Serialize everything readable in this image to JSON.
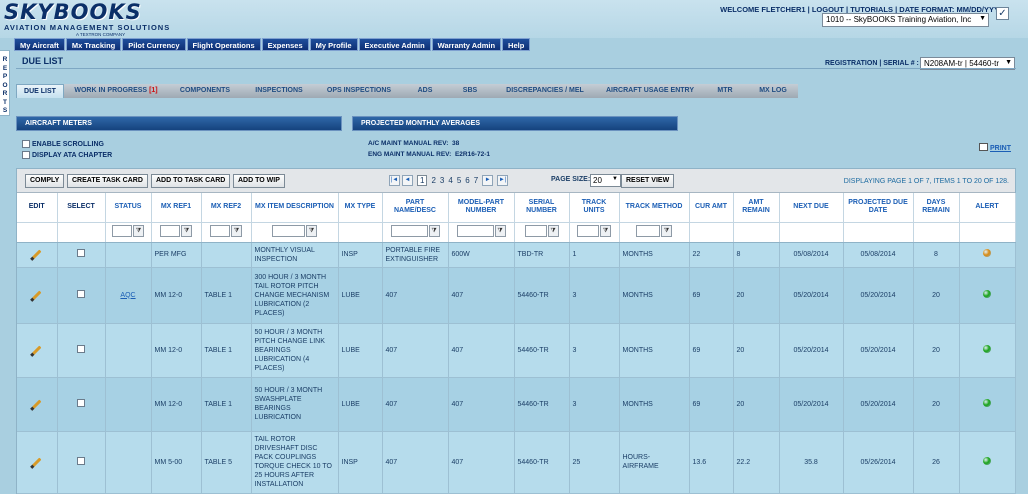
{
  "brand": {
    "logo_text": "SKYBOOKS",
    "subtitle": "AVIATION MANAGEMENT SOLUTIONS",
    "tagline": "A TEXTRON COMPANY"
  },
  "user_bar": {
    "welcome": "WELCOME FLETCHER1",
    "sep": " | ",
    "logout": "LOGOUT",
    "tutorials": "TUTORIALS",
    "date_format": "DATE FORMAT: MM/DD/YYYY",
    "tenant": "1010 -- SkyBOOKS Training Aviation, Inc"
  },
  "side_tab": {
    "label": "REPORTS"
  },
  "nav": [
    "My Aircraft",
    "Mx Tracking",
    "Pilot Currency",
    "Flight Operations",
    "Expenses",
    "My Profile",
    "Executive Admin",
    "Warranty Admin",
    "Help"
  ],
  "page": {
    "title": "DUE LIST",
    "reg_label": "REGISTRATION | SERIAL # :",
    "reg_value": "N208AM-tr | 54460-tr"
  },
  "tabs": [
    {
      "label": "DUE LIST"
    },
    {
      "label": "WORK IN PROGRESS",
      "badge": "[1]"
    },
    {
      "label": "COMPONENTS"
    },
    {
      "label": "INSPECTIONS"
    },
    {
      "label": "OPS INSPECTIONS"
    },
    {
      "label": "ADS"
    },
    {
      "label": "SBS"
    },
    {
      "label": "DISCREPANCIES / MEL"
    },
    {
      "label": "AIRCRAFT USAGE ENTRY"
    },
    {
      "label": "MTR"
    },
    {
      "label": "MX LOG"
    }
  ],
  "panels": {
    "meters": "AIRCRAFT METERS",
    "projected": "PROJECTED MONTHLY AVERAGES"
  },
  "options": {
    "scrolling": "ENABLE SCROLLING",
    "ata": "DISPLAY ATA CHAPTER"
  },
  "manuals": {
    "ac": "A/C MAINT MANUAL REV:",
    "ac_val": "38",
    "eng": "ENG MAINT MANUAL REV:",
    "eng_val": "E2R16-72-1"
  },
  "print_label": "PRINT",
  "toolbar": {
    "comply": "COMPLY",
    "create_task": "CREATE TASK CARD",
    "add_task": "ADD TO TASK CARD",
    "add_wip": "ADD TO WIP",
    "pages": [
      "1",
      "2",
      "3",
      "4",
      "5",
      "6",
      "7"
    ],
    "current_page": "1",
    "page_size_label": "PAGE SIZE:",
    "page_size": "20",
    "reset": "RESET VIEW",
    "displaying": "DISPLAYING PAGE 1 OF 7, ITEMS 1 TO 20 OF 128."
  },
  "columns": [
    "EDIT",
    "SELECT",
    "STATUS",
    "MX REF1",
    "MX REF2",
    "MX ITEM DESCRIPTION",
    "MX TYPE",
    "PART NAME/DESC",
    "MODEL-PART NUMBER",
    "SERIAL NUMBER",
    "TRACK UNITS",
    "TRACK METHOD",
    "CUR AMT",
    "AMT REMAIN",
    "NEXT DUE",
    "PROJECTED DUE DATE",
    "DAYS REMAIN",
    "ALERT"
  ],
  "rows": [
    {
      "status": "",
      "ref1": "PER MFG",
      "ref2": "",
      "desc": "MONTHLY VISUAL INSPECTION",
      "type": "INSP",
      "part": "PORTABLE FIRE EXTINGUISHER",
      "model": "600W",
      "serial": "TBD-TR",
      "units": "1",
      "method": "MONTHS",
      "cur": "22",
      "remain": "8",
      "next": "05/08/2014",
      "proj": "05/08/2014",
      "days": "8",
      "alert": "orange",
      "alert_color": "#d98a10"
    },
    {
      "status": "AQC",
      "ref1": "MM 12-0",
      "ref2": "TABLE 1",
      "desc": "300 HOUR / 3 MONTH TAIL ROTOR PITCH CHANGE MECHANISM LUBRICATION (2 PLACES)",
      "type": "LUBE",
      "part": "407",
      "model": "407",
      "serial": "54460-TR",
      "units": "3",
      "method": "MONTHS",
      "cur": "69",
      "remain": "20",
      "next": "05/20/2014",
      "proj": "05/20/2014",
      "days": "20",
      "alert": "green",
      "alert_color": "#18a318"
    },
    {
      "status": "",
      "ref1": "MM 12-0",
      "ref2": "TABLE 1",
      "desc": "50 HOUR / 3 MONTH PITCH CHANGE LINK BEARINGS LUBRICATION (4 PLACES)",
      "type": "LUBE",
      "part": "407",
      "model": "407",
      "serial": "54460-TR",
      "units": "3",
      "method": "MONTHS",
      "cur": "69",
      "remain": "20",
      "next": "05/20/2014",
      "proj": "05/20/2014",
      "days": "20",
      "alert": "green",
      "alert_color": "#18a318"
    },
    {
      "status": "",
      "ref1": "MM 12-0",
      "ref2": "TABLE 1",
      "desc": "50 HOUR / 3 MONTH SWASHPLATE BEARINGS LUBRICATION",
      "type": "LUBE",
      "part": "407",
      "model": "407",
      "serial": "54460-TR",
      "units": "3",
      "method": "MONTHS",
      "cur": "69",
      "remain": "20",
      "next": "05/20/2014",
      "proj": "05/20/2014",
      "days": "20",
      "alert": "green",
      "alert_color": "#18a318"
    },
    {
      "status": "",
      "ref1": "MM 5-00",
      "ref2": "TABLE 5",
      "desc": "TAIL ROTOR DRIVESHAFT DISC PACK COUPLINGS TORQUE CHECK 10 TO 25 HOURS AFTER INSTALLATION",
      "type": "INSP",
      "part": "407",
      "model": "407",
      "serial": "54460-TR",
      "units": "25",
      "method": "HOURS-AIRFRAME",
      "cur": "13.6",
      "remain": "22.2",
      "next": "35.8",
      "proj": "05/26/2014",
      "days": "26",
      "alert": "green",
      "alert_color": "#18a318"
    }
  ]
}
